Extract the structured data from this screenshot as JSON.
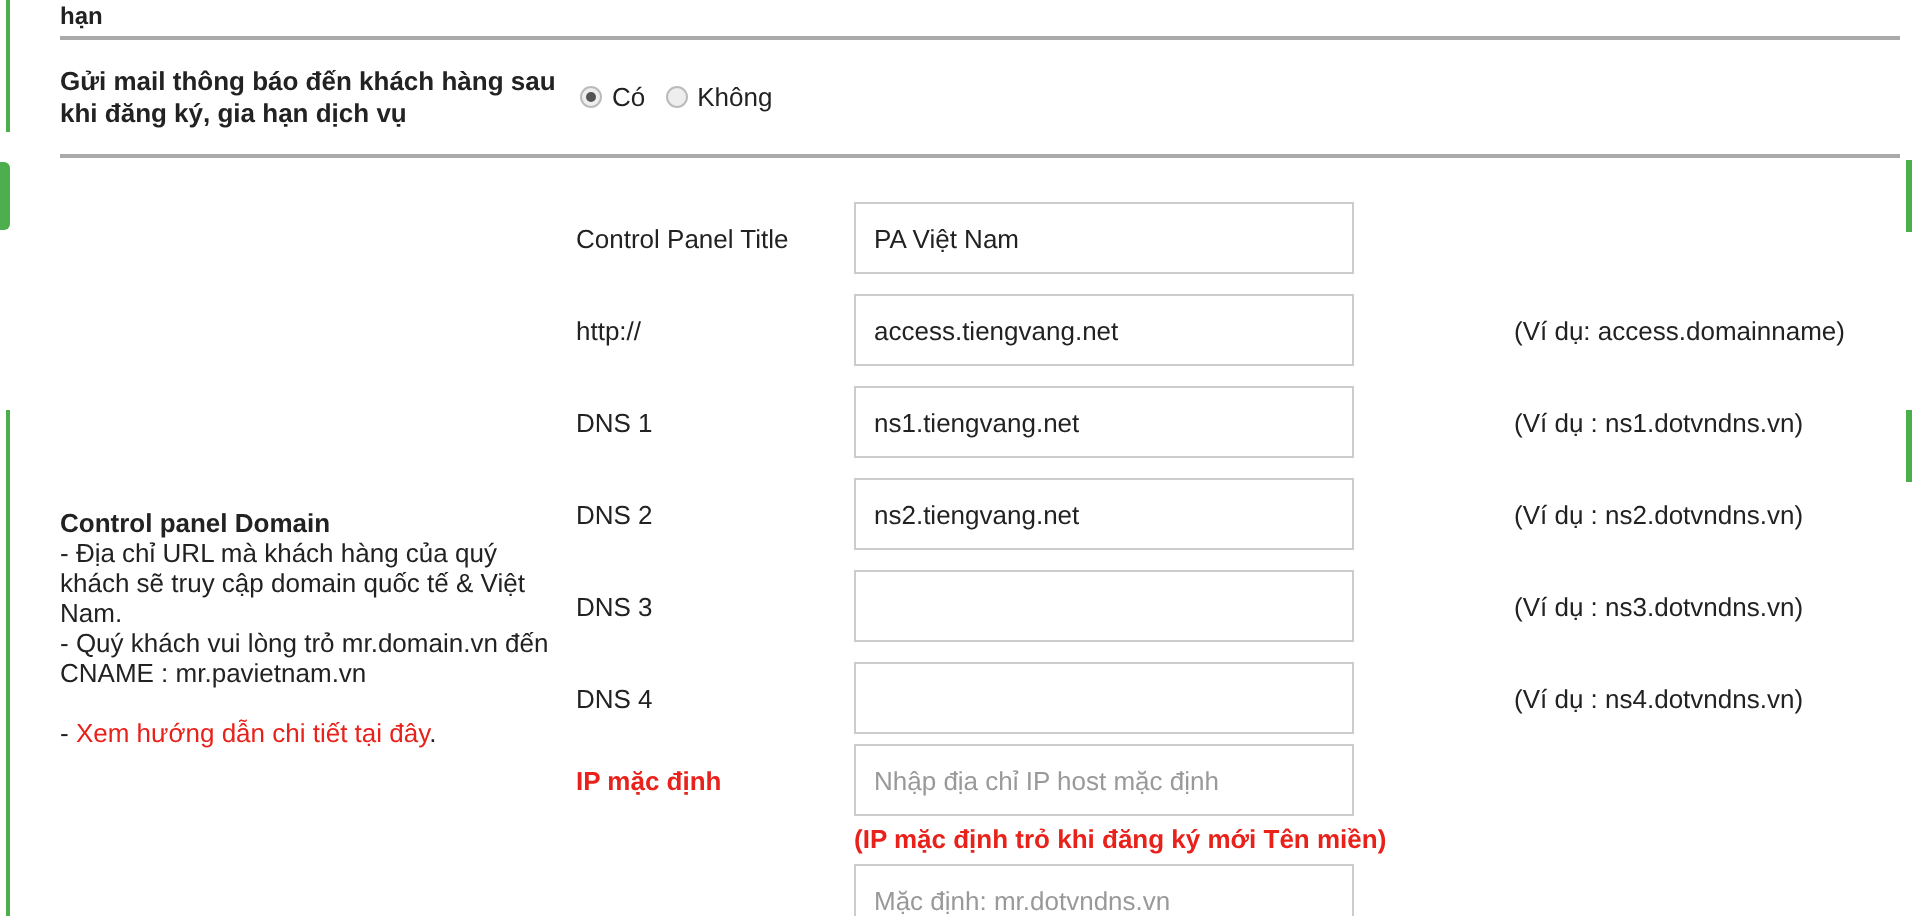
{
  "top_label_fragment": "hạn",
  "notify": {
    "label": "Gửi mail thông báo đến khách hàng sau khi đăng ký, gia hạn dịch vụ",
    "options": [
      {
        "label": "Có",
        "selected": true
      },
      {
        "label": "Không",
        "selected": false
      }
    ]
  },
  "control_panel": {
    "title": "Control panel Domain",
    "lines": [
      "- Địa chỉ URL mà khách hàng của quý khách sẽ truy cập domain quốc tế & Việt Nam.",
      "- Quý khách vui lòng trỏ mr.domain.vn đến CNAME : mr.pavietnam.vn"
    ],
    "link_prefix": "- ",
    "link": "Xem hướng dẫn chi tiết tại đây",
    "link_suffix": "."
  },
  "fields": [
    {
      "kind": "plain",
      "label": "Control Panel Title",
      "value": "PA Việt Nam"
    },
    {
      "kind": "plain",
      "label": "http://",
      "value": "access.tiengvang.net",
      "hint": "(Ví dụ: access.domainname)"
    },
    {
      "kind": "plain",
      "label": "DNS 1",
      "value": "ns1.tiengvang.net",
      "hint": "(Ví dụ : ns1.dotvndns.vn)"
    },
    {
      "kind": "plain",
      "label": "DNS 2",
      "value": "ns2.tiengvang.net",
      "hint": "(Ví dụ : ns2.dotvndns.vn)"
    },
    {
      "kind": "plain",
      "label": "DNS 3",
      "hint": "(Ví dụ : ns3.dotvndns.vn)"
    },
    {
      "kind": "plain",
      "label": "DNS 4",
      "hint": "(Ví dụ : ns4.dotvndns.vn)"
    },
    {
      "kind": "required",
      "label": "IP mặc định",
      "placeholder": "Nhập địa chỉ IP host mặc định",
      "note": "(IP mặc định trỏ khi đăng ký mới Tên miền)"
    },
    {
      "kind": "plain",
      "placeholder": "Mặc định: mr.dotvndns.vn"
    }
  ]
}
